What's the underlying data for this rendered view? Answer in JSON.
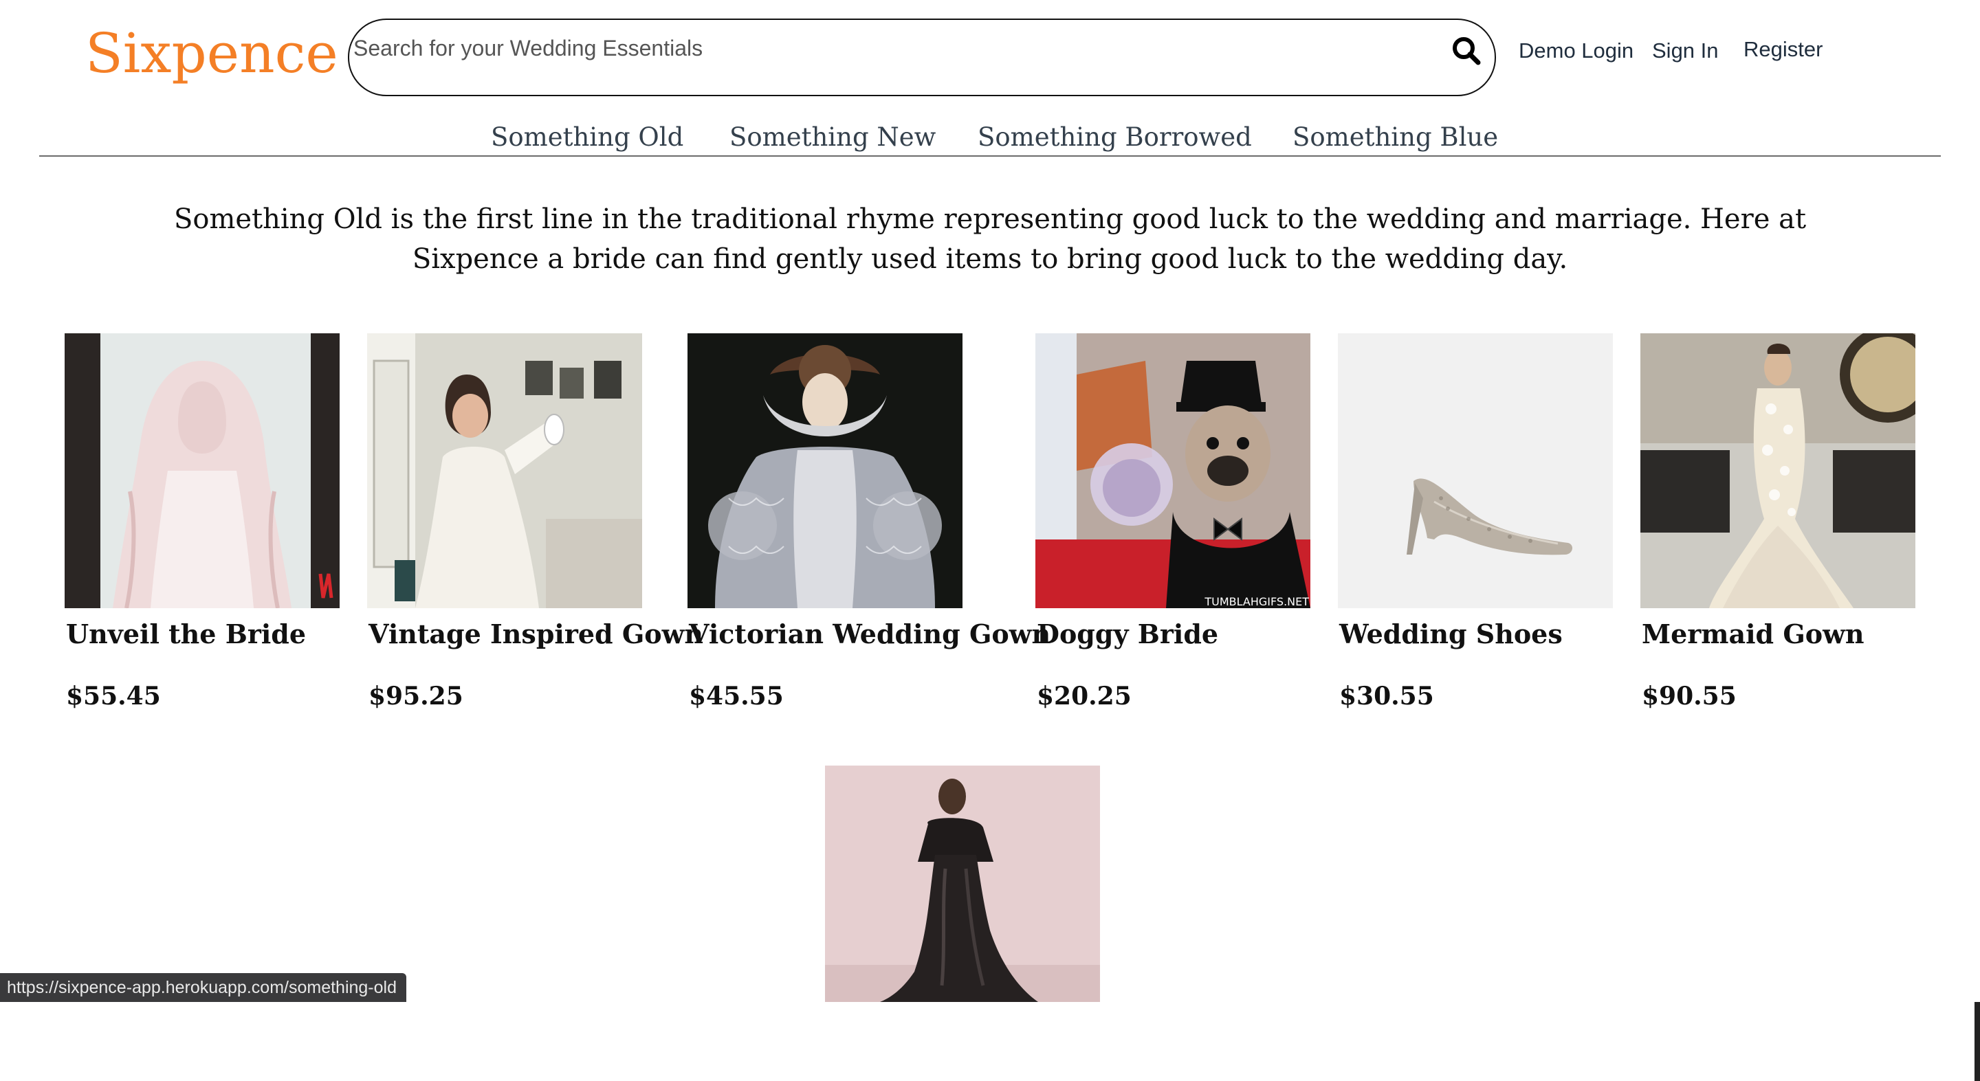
{
  "header": {
    "logo": "Sixpence",
    "search_placeholder": "Search for your Wedding Essentials",
    "auth": {
      "demo_login": "Demo Login",
      "sign_in": "Sign In",
      "register": "Register"
    }
  },
  "nav": {
    "items": [
      {
        "label": "Something Old"
      },
      {
        "label": "Something New"
      },
      {
        "label": "Something Borrowed"
      },
      {
        "label": "Something Blue"
      }
    ]
  },
  "intro": "Something Old is the first line in the traditional rhyme representing good luck to the wedding and marriage. Here at Sixpence a bride can find gently used items to bring good luck to the wedding day.",
  "products": [
    {
      "title": "Unveil the Bride",
      "price": "$55.45",
      "icon": "bride-veil-image"
    },
    {
      "title": "Vintage Inspired Gown",
      "price": "$95.25",
      "icon": "vintage-gown-image"
    },
    {
      "title": "Victorian Wedding Gown",
      "price": "$45.55",
      "icon": "victorian-gown-image"
    },
    {
      "title": "Doggy Bride",
      "price": "$20.25",
      "icon": "doggy-bride-image"
    },
    {
      "title": "Wedding Shoes",
      "price": "$30.55",
      "icon": "wedding-shoes-image"
    },
    {
      "title": "Mermaid Gown",
      "price": "$90.55",
      "icon": "mermaid-gown-image"
    },
    {
      "title": "",
      "price": "",
      "icon": "black-satin-gown-image"
    }
  ],
  "image_captions": {
    "doggy_watermark": "TUMBLAHGIFS.NET"
  },
  "status_bar": {
    "url": "https://sixpence-app.herokuapp.com/something-old"
  },
  "colors": {
    "brand": "#f47f26",
    "nav_text": "#34404c",
    "status_bar_bg": "#3a3a3c"
  }
}
